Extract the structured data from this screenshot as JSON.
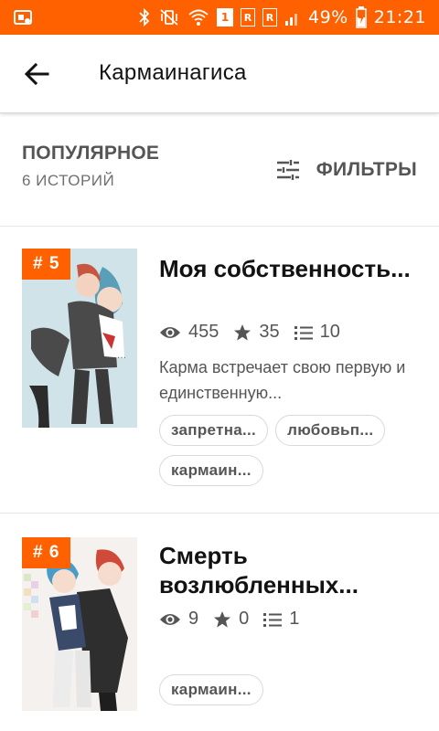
{
  "status_bar": {
    "sim_slot": "1",
    "network_r1": "R",
    "network_r2": "R",
    "battery": "49%",
    "time": "21:21",
    "accent": "#ff6100"
  },
  "app_bar": {
    "title": "Кармаинагиса",
    "back_icon": "arrow-back-icon"
  },
  "section": {
    "title": "ПОПУЛЯРНОЕ",
    "count": "6 ИСТОРИЙ",
    "filter_label": "ФИЛЬТРЫ",
    "filter_icon": "sliders-icon"
  },
  "stories": [
    {
      "rank": "# 5",
      "title": "Моя собственность...",
      "views": "455",
      "votes": "35",
      "parts": "10",
      "description": "Карма встречает свою первую и единственную...",
      "tags": [
        "запретна...",
        "любовьп...",
        "кармаин..."
      ]
    },
    {
      "rank": "# 6",
      "title": "Смерть возлюбленных...",
      "views": "9",
      "votes": "0",
      "parts": "1",
      "description": "",
      "tags": [
        "кармаин..."
      ]
    }
  ]
}
